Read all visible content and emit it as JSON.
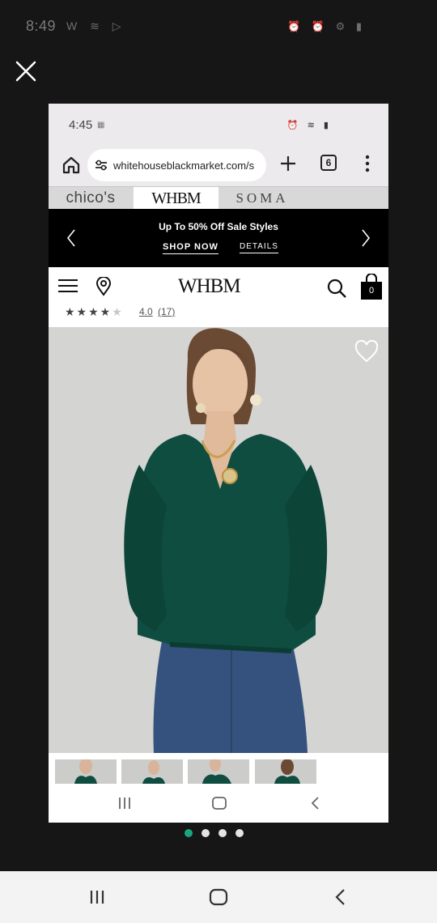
{
  "outer": {
    "status_time": "8:49",
    "status_left_icons": "W ≋ ▷",
    "status_right_icons": "⏰ ⏰ ⚙ ▮",
    "carousel_dots": 4,
    "carousel_active_index": 0,
    "accent_color": "#1ba57f"
  },
  "inner": {
    "status_time": "4:45",
    "status_left_icon": "▦",
    "status_right_icons": "⏰ ≋ ▮",
    "url": "whitehouseblackmarket.com/s",
    "tab_count": "6",
    "brand_tabs": [
      "chico's",
      "WHBM",
      "SOMA"
    ],
    "promo": {
      "title": "Up To 50% Off Sale Styles",
      "shop_label": "SHOP NOW",
      "details_label": "DETAILS"
    },
    "site": {
      "logo": "WHBM",
      "cart_count": "0"
    },
    "rating": {
      "stars": 4,
      "max_stars": 5,
      "value": "4.0",
      "count": "(17)"
    },
    "product": {
      "sweater_color": "#0f4d40",
      "thumbnail_count": 4
    }
  }
}
